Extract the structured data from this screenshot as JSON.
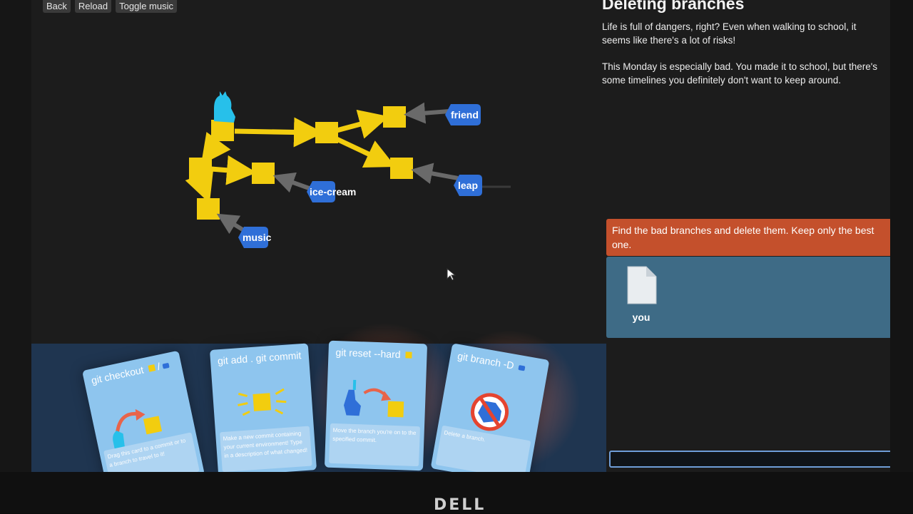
{
  "topbar": {
    "back": "Back",
    "reload": "Reload",
    "toggle_music": "Toggle music"
  },
  "level": {
    "title": "Deleting branches",
    "paragraphs": [
      "Life is full of dangers, right? Even when walking to school, it seems like there's a lot of risks!",
      "This Monday is especially bad. You made it to school, but there's some timelines you definitely don't want to keep around."
    ],
    "goal": "Find the bad branches and delete them. Keep only the best one."
  },
  "inventory": {
    "items": [
      {
        "label": "you",
        "icon": "file-icon"
      }
    ]
  },
  "branches": {
    "friend": "friend",
    "leap": "leap",
    "ice_cream": "ice-cream",
    "music": "music"
  },
  "cards": [
    {
      "title": "git checkout",
      "icons": [
        "commit-square-icon",
        "branch-tag-icon"
      ],
      "separator": "/",
      "description": "Drag this card to a commit or to a branch to travel to it!"
    },
    {
      "title": "git add . git commit",
      "description": "Make a new commit containing your current environment! Type in a description of what changed!"
    },
    {
      "title": "git reset --hard",
      "description": "Move the branch you're on to the specified commit."
    },
    {
      "title": "git branch -D",
      "description": "Delete a branch."
    }
  ],
  "colors": {
    "commit": "#f2cd0f",
    "branch_tag": "#2f6fd8",
    "player": "#27c0ea",
    "goal_banner": "#c4502c",
    "inventory_panel": "#3e6b86",
    "card": "#8ec5ee"
  },
  "logo": "DELL"
}
